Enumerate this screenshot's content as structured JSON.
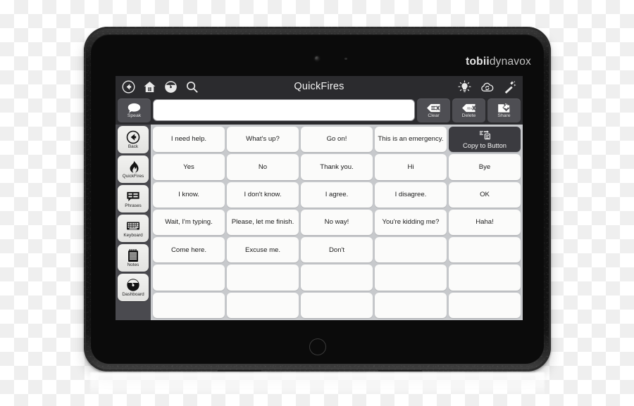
{
  "device": {
    "brand_bold": "tobii",
    "brand_light": "dynavox"
  },
  "titlebar": {
    "title": "QuickFires",
    "left_icons": [
      {
        "name": "back-icon",
        "label": "Back"
      },
      {
        "name": "home-icon",
        "label": "Home"
      },
      {
        "name": "dashboard-gauge-icon",
        "label": "Dashboard"
      },
      {
        "name": "search-icon",
        "label": "Search"
      }
    ],
    "right_icons": [
      {
        "name": "lightbulb-icon",
        "label": "Hints"
      },
      {
        "name": "cloud-sync-icon",
        "label": "Sync"
      },
      {
        "name": "magic-wand-icon",
        "label": "Edit"
      }
    ]
  },
  "messagebar": {
    "speak_label": "Speak",
    "message_value": "",
    "message_placeholder": "",
    "clear_label": "Clear",
    "delete_label": "Delete",
    "share_label": "Share"
  },
  "sidebar": {
    "items": [
      {
        "label": "Back",
        "icon": "back-circle-icon"
      },
      {
        "label": "QuickFires",
        "icon": "flame-icon"
      },
      {
        "label": "Phrases",
        "icon": "phrases-icon"
      },
      {
        "label": "Keyboard",
        "icon": "keyboard-icon"
      },
      {
        "label": "Notes",
        "icon": "notepad-icon"
      },
      {
        "label": "Dashboard",
        "icon": "dashboard-gauge-icon"
      }
    ]
  },
  "grid": {
    "columns": 5,
    "rows": 7,
    "cells": [
      {
        "label": "I need help.",
        "type": "phrase"
      },
      {
        "label": "What's up?",
        "type": "phrase"
      },
      {
        "label": "Go on!",
        "type": "phrase"
      },
      {
        "label": "This is an emergency.",
        "type": "phrase"
      },
      {
        "label": "Copy to Button",
        "type": "action",
        "icon": "copy-to-button-icon"
      },
      {
        "label": "Yes",
        "type": "phrase"
      },
      {
        "label": "No",
        "type": "phrase"
      },
      {
        "label": "Thank you.",
        "type": "phrase"
      },
      {
        "label": "Hi",
        "type": "phrase"
      },
      {
        "label": "Bye",
        "type": "phrase"
      },
      {
        "label": "I know.",
        "type": "phrase"
      },
      {
        "label": "I don't know.",
        "type": "phrase"
      },
      {
        "label": "I agree.",
        "type": "phrase"
      },
      {
        "label": "I disagree.",
        "type": "phrase"
      },
      {
        "label": "OK",
        "type": "phrase"
      },
      {
        "label": "Wait, I'm typing.",
        "type": "phrase"
      },
      {
        "label": "Please, let me finish.",
        "type": "phrase"
      },
      {
        "label": "No way!",
        "type": "phrase"
      },
      {
        "label": "You're kidding me?",
        "type": "phrase"
      },
      {
        "label": "Haha!",
        "type": "phrase"
      },
      {
        "label": "Come here.",
        "type": "phrase"
      },
      {
        "label": "Excuse me.",
        "type": "phrase"
      },
      {
        "label": "Don't",
        "type": "phrase"
      },
      {
        "label": "",
        "type": "empty"
      },
      {
        "label": "",
        "type": "empty"
      },
      {
        "label": "",
        "type": "empty"
      },
      {
        "label": "",
        "type": "empty"
      },
      {
        "label": "",
        "type": "empty"
      },
      {
        "label": "",
        "type": "empty"
      },
      {
        "label": "",
        "type": "empty"
      },
      {
        "label": "",
        "type": "empty"
      },
      {
        "label": "",
        "type": "empty"
      },
      {
        "label": "",
        "type": "empty"
      },
      {
        "label": "",
        "type": "empty"
      },
      {
        "label": "",
        "type": "empty"
      }
    ]
  },
  "colors": {
    "chrome_dark": "#2b2b2e",
    "sidebar_bg": "#4a4a4f",
    "grid_gap": "#c7c9cc",
    "cell_bg": "#fbfbfa",
    "action_bg": "#3b3b40",
    "tool_bg": "#4e4e53"
  }
}
